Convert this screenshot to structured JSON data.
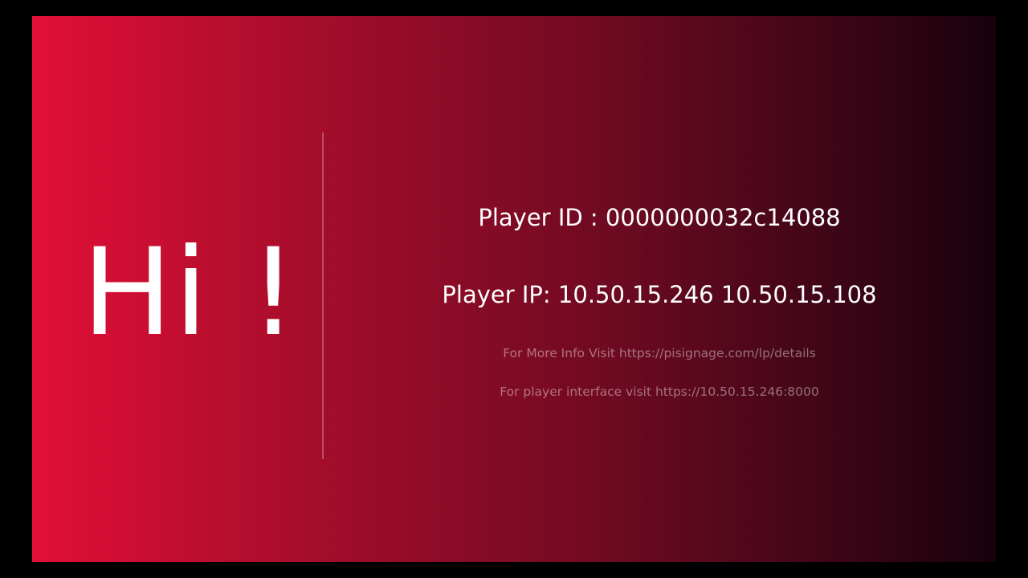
{
  "greeting": "Hi !",
  "player": {
    "id_line": "Player ID : 0000000032c14088",
    "ip_line": "Player IP: 10.50.15.246 10.50.15.108"
  },
  "links": {
    "more_info": "For More Info Visit https://pisignage.com/lp/details",
    "player_interface": "For player interface visit https://10.50.15.246:8000"
  },
  "colors": {
    "gradient_start": "#e20f37",
    "gradient_end": "#17010c",
    "text": "#ffffff"
  }
}
